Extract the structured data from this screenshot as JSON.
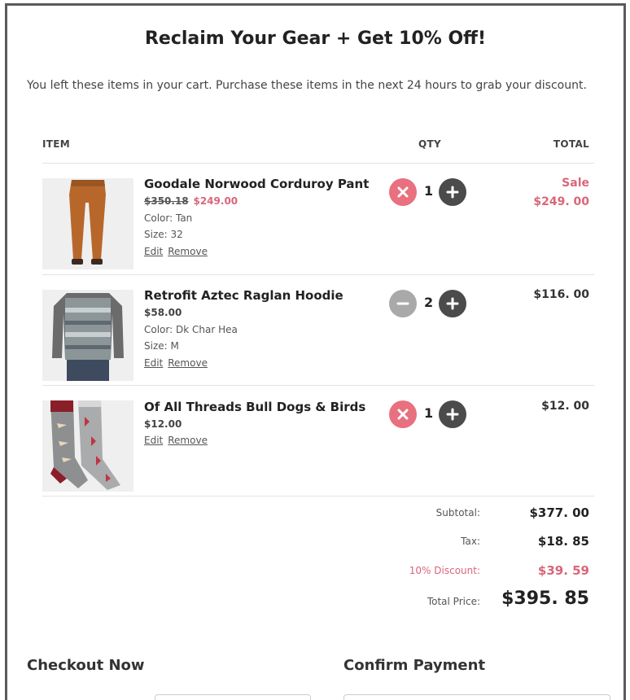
{
  "email": {
    "title": "Reclaim Your Gear + Get 10% Off!",
    "intro": "You left these items in your cart. Purchase these items in the next 24 hours to grab your discount."
  },
  "cart": {
    "columns": {
      "item": "ITEM",
      "qty": "QTY",
      "total": "TOTAL"
    },
    "edit_label": "Edit",
    "remove_label": "Remove",
    "items": [
      {
        "name": "Goodale Norwood Corduroy Pant",
        "original_price": "$350.18",
        "sale_price": "$249.00",
        "color": "Color: Tan",
        "size": "Size: 32",
        "qty": "1",
        "badge": "Sale",
        "total": "$249. 00",
        "decrement_icon": "remove-x-icon"
      },
      {
        "name": "Retrofit Aztec Raglan Hoodie",
        "price": "$58.00",
        "color": "Color: Dk Char Hea",
        "size": "Size: M",
        "qty": "2",
        "total": "$116. 00",
        "decrement_icon": "minus-icon"
      },
      {
        "name": "Of All Threads Bull Dogs & Birds",
        "price": "$12.00",
        "qty": "1",
        "total": "$12. 00",
        "decrement_icon": "remove-x-icon"
      }
    ]
  },
  "summary": {
    "subtotal_label": "Subtotal:",
    "subtotal": "$377. 00",
    "tax_label": "Tax:",
    "tax": "$18. 85",
    "discount_label": "10% Discount:",
    "discount": "$39. 59",
    "total_label": "Total Price:",
    "total": "$395. 85"
  },
  "sections": {
    "checkout": "Checkout Now",
    "payment": "Confirm Payment"
  },
  "colors": {
    "accent_pink": "#d9667a",
    "remove_button": "#e8707f",
    "plus_button": "#4b4b4b",
    "minus_button": "#a9a9a9"
  }
}
